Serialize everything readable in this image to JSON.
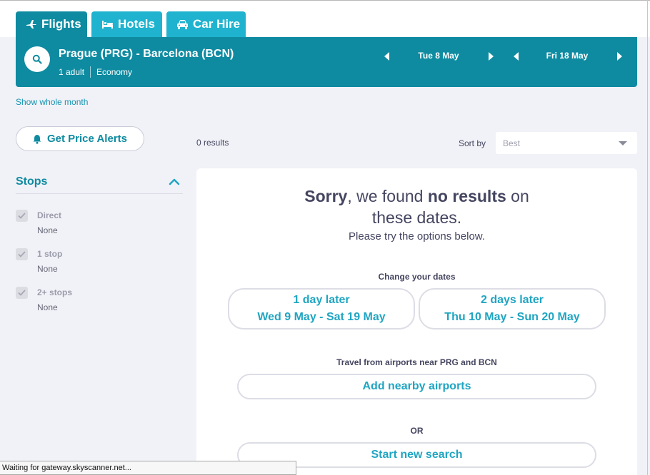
{
  "tabs": [
    {
      "label": "Flights",
      "icon": "plane-icon"
    },
    {
      "label": "Hotels",
      "icon": "bed-icon"
    },
    {
      "label": "Car Hire",
      "icon": "car-icon"
    }
  ],
  "search": {
    "route": "Prague (PRG) - Barcelona (BCN)",
    "travellers": "1 adult",
    "cabin": "Economy",
    "depart_date": "Tue 8 May",
    "return_date": "Fri 18 May"
  },
  "show_month": "Show whole month",
  "price_alerts": "Get Price Alerts",
  "results_count": "0 results",
  "sort": {
    "label": "Sort by",
    "value": "Best"
  },
  "filters": {
    "stops_title": "Stops",
    "options": [
      {
        "label": "Direct",
        "price": "None",
        "checked": true
      },
      {
        "label": "1 stop",
        "price": "None",
        "checked": true
      },
      {
        "label": "2+ stops",
        "price": "None",
        "checked": true
      }
    ]
  },
  "no_results": {
    "sorry": "Sorry",
    "we_found": ", we found ",
    "no_results": "no results",
    "on": " on",
    "these_dates": "these dates.",
    "please": "Please try the options below.",
    "change_dates_label": "Change your dates",
    "option1_title": "1 day later",
    "option1_dates": "Wed 9 May - Sat 19 May",
    "option2_title": "2 days later",
    "option2_dates": "Thu 10 May - Sun 20 May",
    "nearby_label": "Travel from airports near PRG and BCN",
    "nearby_button": "Add nearby airports",
    "or": "OR",
    "new_search_button": "Start new search"
  },
  "statusbar": "Waiting for gateway.skyscanner.net...",
  "colors": {
    "brand_dark": "#0e8ba1",
    "brand_light": "#1fb3cf",
    "link": "#1fa5c2",
    "background": "#f1f2f7"
  }
}
